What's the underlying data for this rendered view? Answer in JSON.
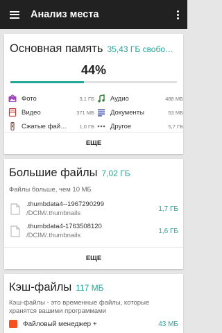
{
  "appbar": {
    "title": "Анализ места"
  },
  "colors": {
    "accent": "#26a69a",
    "appbar": "#212121"
  },
  "internal_storage": {
    "title": "Основная память",
    "free": "35,43 ГБ свобо…",
    "percent_label": "44%",
    "used_fraction": 0.44,
    "categories": [
      {
        "icon": "image-icon",
        "label": "Фото",
        "size": "3,1 ГБ"
      },
      {
        "icon": "music-note-icon",
        "label": "Аудио",
        "size": "488 МБ"
      },
      {
        "icon": "video-icon",
        "label": "Видео",
        "size": "371 МБ"
      },
      {
        "icon": "document-icon",
        "label": "Документы",
        "size": "53 МБ"
      },
      {
        "icon": "archive-icon",
        "label": "Сжатые фай…",
        "size": "1,0 ГБ"
      },
      {
        "icon": "more-dots-icon",
        "label": "Другое",
        "size": "5,7 ГБ"
      }
    ],
    "more_label": "ЕЩЕ"
  },
  "large_files": {
    "title": "Большие файлы",
    "total": "7,02 ГБ",
    "description": "Файлы больше, чем 10 МБ",
    "files": [
      {
        "name": ".thumbdata4--1967290299",
        "path": "/DCIM/.thumbnails",
        "size": "1,7 ГБ"
      },
      {
        "name": ".thumbdata4-1763508120",
        "path": "/DCIM/.thumbnails",
        "size": "1,6 ГБ"
      }
    ],
    "more_label": "ЕЩЕ"
  },
  "cache_files": {
    "title": "Кэш-файлы",
    "total": "117 МБ",
    "description": "Кэш-файлы - это временные файлы, которые хранятся вашими программами",
    "apps": [
      {
        "name": "Файловый менеджер +",
        "size": "43 МБ"
      }
    ]
  }
}
